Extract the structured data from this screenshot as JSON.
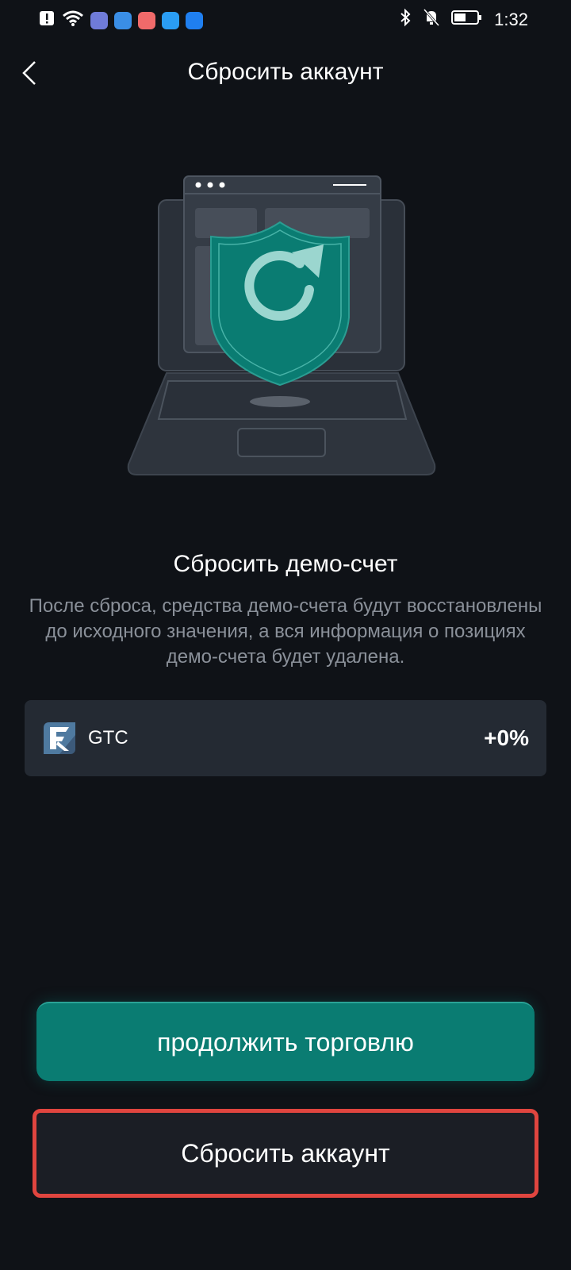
{
  "status_bar": {
    "time": "1:32",
    "left_icons": [
      "alert-icon",
      "wifi-icon",
      "music-app-icon",
      "browser-app-icon",
      "shop-app-icon",
      "search-app-icon",
      "cloud-app-icon"
    ],
    "right_icons": [
      "bluetooth-icon",
      "mute-icon",
      "battery-icon"
    ]
  },
  "header": {
    "title": "Сбросить аккаунт"
  },
  "content": {
    "section_title": "Сбросить демо-счет",
    "description": "После сброса, средства демо-счета будут восстановлены до исходного значения, а вся информация о позициях демо-счета будет удалена."
  },
  "asset": {
    "name": "GTC",
    "change": "+0%"
  },
  "buttons": {
    "continue_label": "продолжить торговлю",
    "reset_label": "Сбросить аккаунт"
  },
  "colors": {
    "accent": "#0a7c72",
    "background": "#0f1217",
    "highlight_border": "#e0453f"
  }
}
